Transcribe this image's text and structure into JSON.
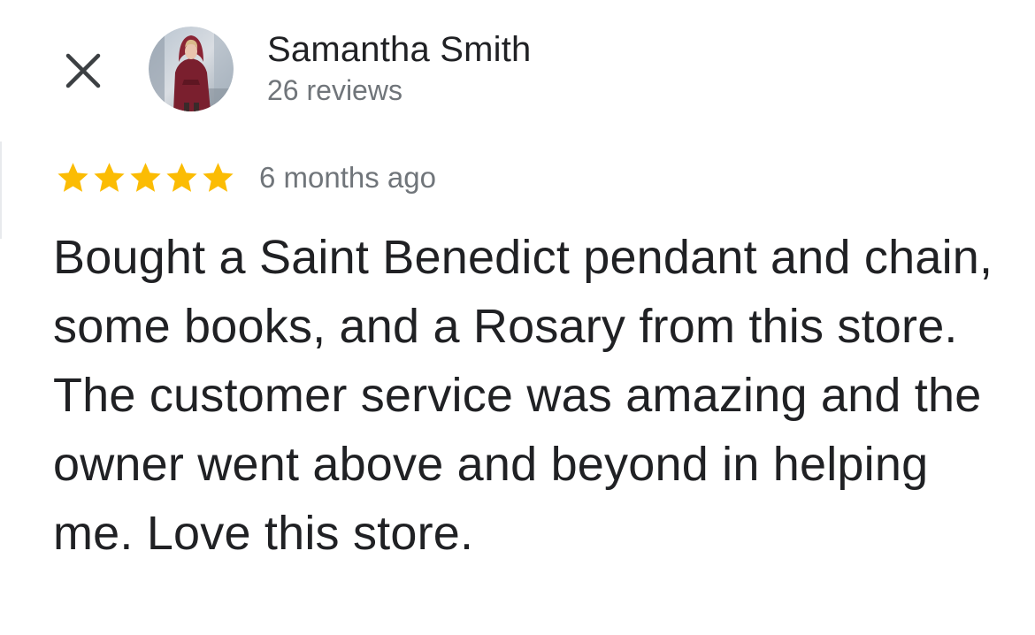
{
  "reviewer": {
    "name": "Samantha Smith",
    "review_count": "26 reviews",
    "avatar_icon": "profile-photo"
  },
  "review": {
    "rating": 5,
    "rating_max": 5,
    "time_ago": "6 months ago",
    "text": "Bought a Saint Benedict pendant and chain, some books, and a Rosary from this store. The customer service was amazing and the owner went above and beyond in helping me. Love this store."
  },
  "icons": {
    "close": "close-icon",
    "star": "star-icon"
  },
  "colors": {
    "star": "#fbbc04",
    "primary_text": "#202124",
    "secondary_text": "#70757a",
    "background": "#ffffff"
  }
}
